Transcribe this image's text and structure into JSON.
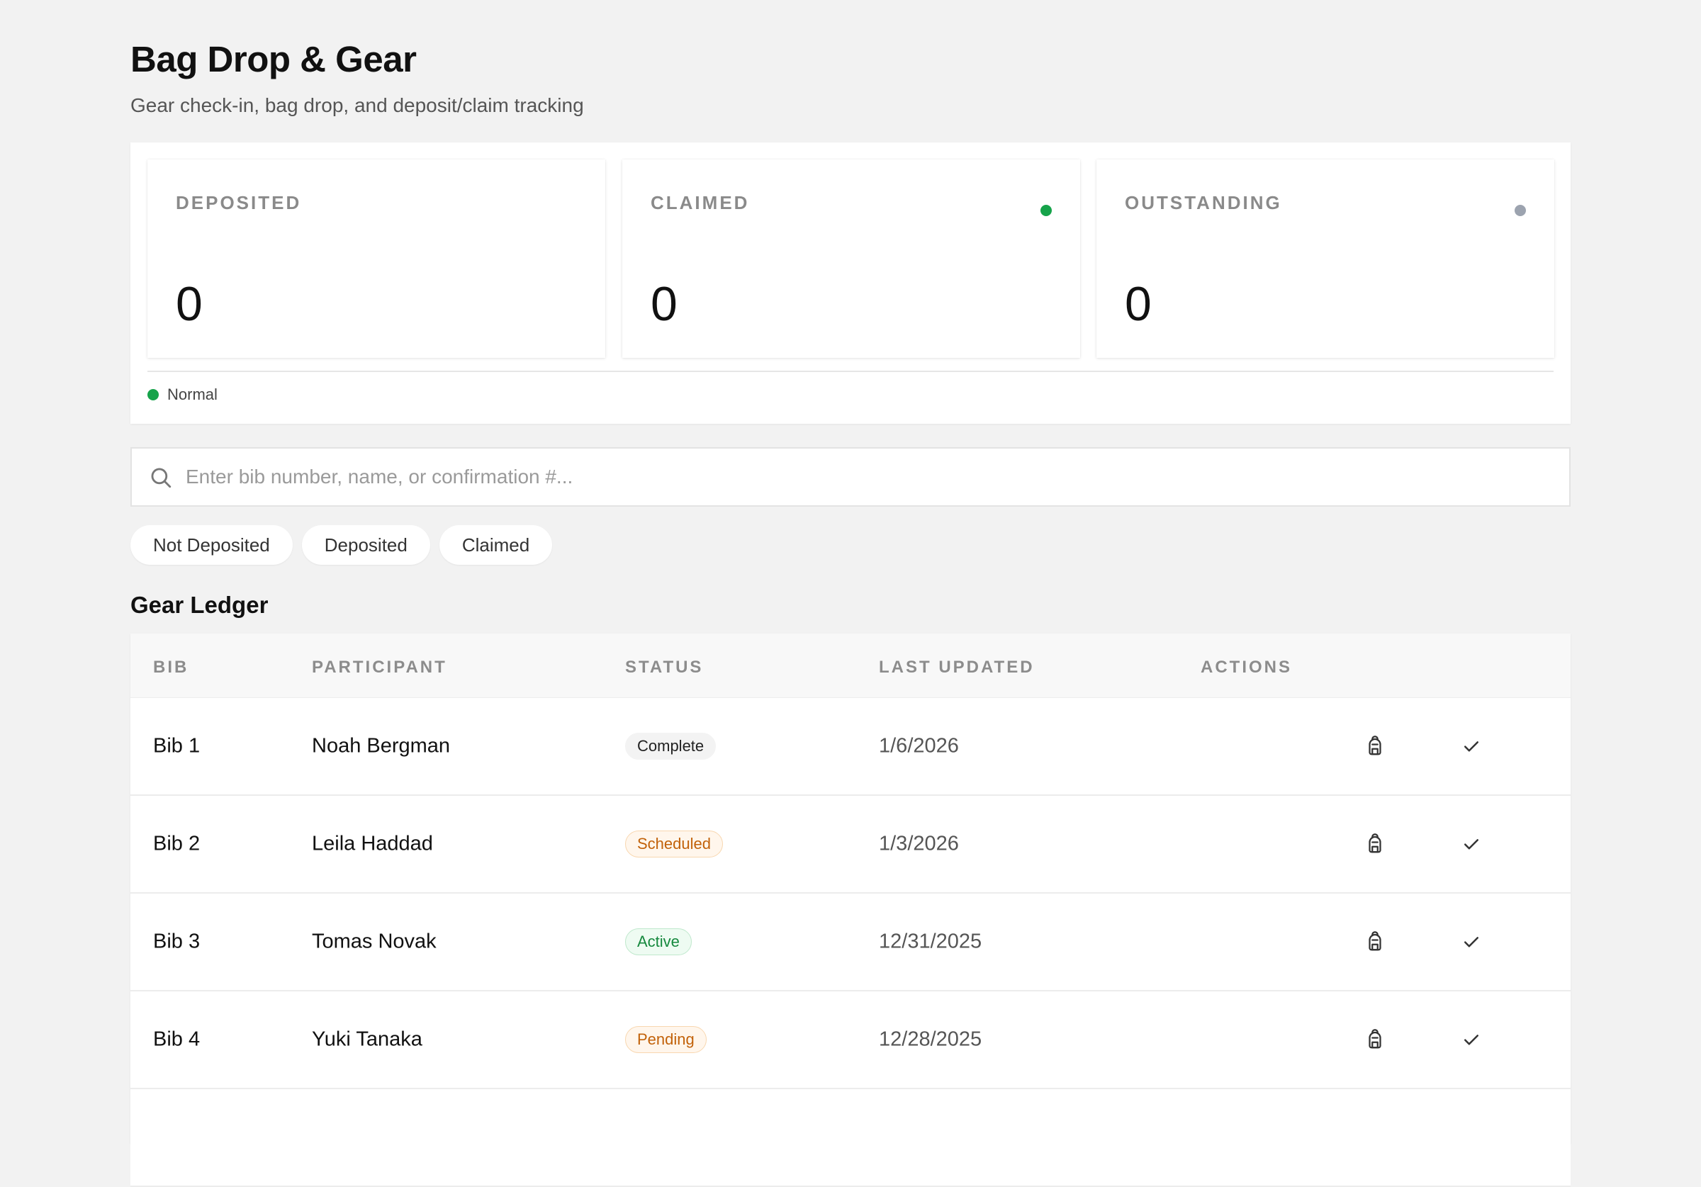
{
  "header": {
    "title": "Bag Drop & Gear",
    "subtitle": "Gear check-in, bag drop, and deposit/claim tracking"
  },
  "stats": [
    {
      "label": "DEPOSITED",
      "value": "0",
      "dot_color": null
    },
    {
      "label": "CLAIMED",
      "value": "0",
      "dot_color": "#16a34a"
    },
    {
      "label": "OUTSTANDING",
      "value": "0",
      "dot_color": "#9ca3af"
    }
  ],
  "legend": {
    "label": "Normal",
    "color": "#16a34a"
  },
  "search": {
    "placeholder": "Enter bib number, name, or confirmation #...",
    "value": "",
    "icon": "search-icon"
  },
  "filters": [
    "Not Deposited",
    "Deposited",
    "Claimed"
  ],
  "ledger": {
    "title": "Gear Ledger",
    "columns": [
      "BIB",
      "PARTICIPANT",
      "STATUS",
      "LAST UPDATED",
      "ACTIONS"
    ],
    "rows": [
      {
        "bib": "Bib 1",
        "participant": "Noah Bergman",
        "status": "Complete",
        "status_color": "#222222",
        "status_bg": "#f3f3f3",
        "status_border": "#f3f3f3",
        "updated": "1/6/2026"
      },
      {
        "bib": "Bib 2",
        "participant": "Leila Haddad",
        "status": "Scheduled",
        "status_color": "#c2620a",
        "status_bg": "#fff6ec",
        "status_border": "#f8d7b0",
        "updated": "1/3/2026"
      },
      {
        "bib": "Bib 3",
        "participant": "Tomas Novak",
        "status": "Active",
        "status_color": "#16893e",
        "status_bg": "#eefbf2",
        "status_border": "#bfe8cc",
        "updated": "12/31/2025"
      },
      {
        "bib": "Bib 4",
        "participant": "Yuki Tanaka",
        "status": "Pending",
        "status_color": "#c2620a",
        "status_bg": "#fff6ec",
        "status_border": "#f8d7b0",
        "updated": "12/28/2025"
      },
      {
        "bib": "",
        "participant": "",
        "status": "",
        "status_color": "#222222",
        "status_bg": "#ffffff",
        "status_border": "#ffffff",
        "updated": ""
      }
    ],
    "action_icons": [
      "backpack-icon",
      "check-icon"
    ]
  }
}
